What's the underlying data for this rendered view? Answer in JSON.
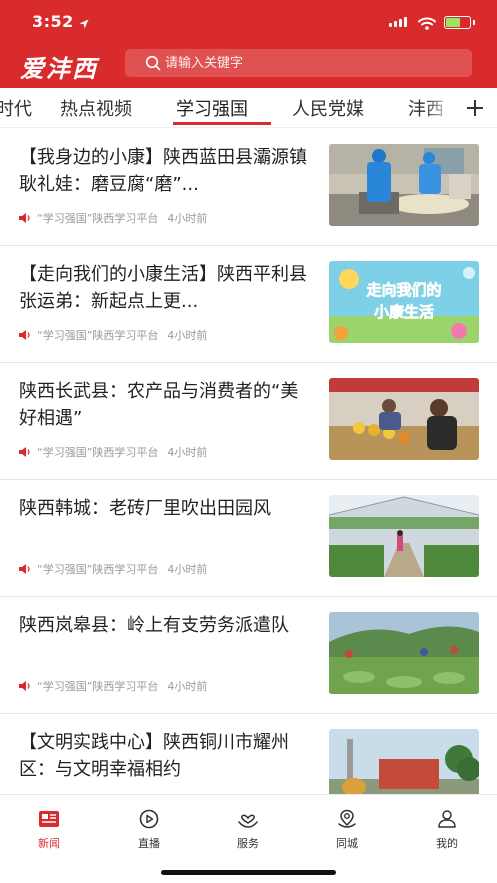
{
  "status": {
    "time": "3:52"
  },
  "app": {
    "logo": "爱沣西"
  },
  "search": {
    "placeholder": "请输入关键字"
  },
  "tabs": [
    {
      "label": "时代"
    },
    {
      "label": "热点视频"
    },
    {
      "label": "学习强国",
      "active": true
    },
    {
      "label": "人民党媒"
    },
    {
      "label": "沣西"
    }
  ],
  "news": [
    {
      "title": "【我身边的小康】陕西蓝田县灞源镇耿礼娃：磨豆腐“磨”...",
      "source": "“学习强国”陕西学习平台",
      "time": "4小时前"
    },
    {
      "title": "【走向我们的小康生活】陕西平利县张运弟：新起点上更...",
      "source": "“学习强国”陕西学习平台",
      "time": "4小时前",
      "thumb_text": "走向我们的小康生活"
    },
    {
      "title": "陕西长武县：农产品与消费者的“美好相遇”",
      "source": "“学习强国”陕西学习平台",
      "time": "4小时前"
    },
    {
      "title": "陕西韩城：老砖厂里吹出田园风",
      "source": "“学习强国”陕西学习平台",
      "time": "4小时前"
    },
    {
      "title": "陕西岚皋县：岭上有支劳务派遣队",
      "source": "“学习强国”陕西学习平台",
      "time": "4小时前"
    },
    {
      "title": "【文明实践中心】陕西铜川市耀州区：与文明幸福相约",
      "source": "",
      "time": ""
    }
  ],
  "nav": [
    {
      "label": "新闻",
      "icon": "news-icon",
      "active": true
    },
    {
      "label": "直播",
      "icon": "play-icon"
    },
    {
      "label": "服务",
      "icon": "heart-hand-icon"
    },
    {
      "label": "同城",
      "icon": "location-icon"
    },
    {
      "label": "我的",
      "icon": "user-icon"
    }
  ],
  "colors": {
    "brand": "#d92b2b",
    "text": "#222222",
    "meta": "#999999"
  }
}
